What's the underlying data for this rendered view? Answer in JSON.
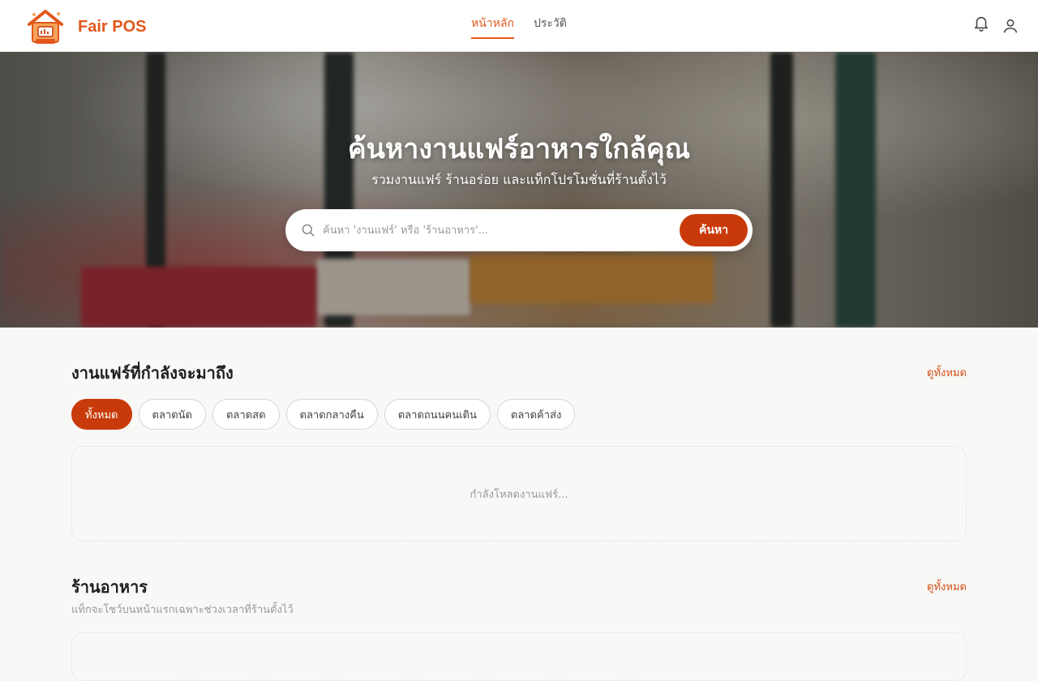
{
  "header": {
    "brand": "Fair POS",
    "nav": [
      {
        "label": "หน้าหลัก",
        "active": true
      },
      {
        "label": "ประวัติ",
        "active": false
      }
    ],
    "icons": [
      "bell-icon",
      "user-icon"
    ]
  },
  "hero": {
    "title": "ค้นหางานแฟร์อาหารใกล้คุณ",
    "subtitle": "รวมงานแฟร์ ร้านอร่อย และแท็กโปรโมชั่นที่ร้านตั้งไว้",
    "search": {
      "placeholder": "ค้นหา 'งานแฟร์' หรือ 'ร้านอาหาร'...",
      "value": "",
      "button": "ค้นหา"
    }
  },
  "fairs": {
    "title": "งานแฟร์ที่กำลังจะมาถึง",
    "see_all": "ดูทั้งหมด",
    "filters": [
      {
        "label": "ทั้งหมด",
        "active": true
      },
      {
        "label": "ตลาดนัด",
        "active": false
      },
      {
        "label": "ตลาดสด",
        "active": false
      },
      {
        "label": "ตลาดกลางคืน",
        "active": false
      },
      {
        "label": "ตลาดถนนคนเดิน",
        "active": false
      },
      {
        "label": "ตลาดค้าส่ง",
        "active": false
      }
    ],
    "loading": "กำลังโหลดงานแฟร์..."
  },
  "restaurants": {
    "title": "ร้านอาหาร",
    "subtitle": "แท็กจะโชว์บนหน้าแรกเฉพาะช่วงเวลาที่ร้านตั้งไว้",
    "see_all": "ดูทั้งหมด"
  },
  "colors": {
    "accent": "#e1571c",
    "primary_button": "#c93a0a"
  }
}
